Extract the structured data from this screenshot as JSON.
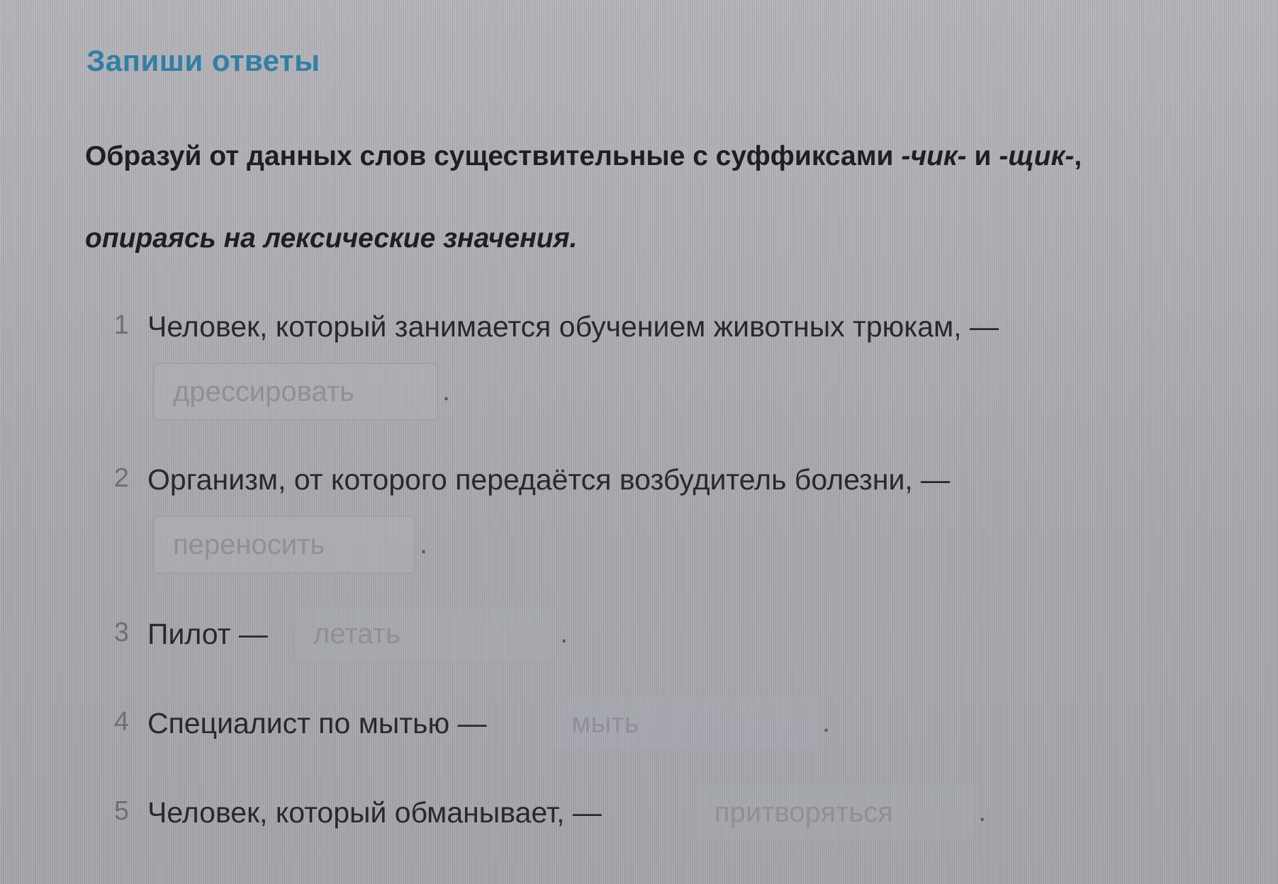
{
  "exercise": {
    "section_title": "Запиши ответы",
    "instruction_part1": "Образуй от данных слов существительные с суффиксами ",
    "suffix1": "-чик-",
    "instruction_and": " и ",
    "suffix2": "-щик-",
    "instruction_comma": ",",
    "instruction_line2": "опираясь на лексические значения.",
    "period": "."
  },
  "items": [
    {
      "number": "1",
      "text": "Человек, который занимается обучением животных трюкам, —",
      "placeholder": "дрессировать"
    },
    {
      "number": "2",
      "text": "Организм, от которого передаётся возбудитель болезни, —",
      "placeholder": "переносить"
    },
    {
      "number": "3",
      "text": "Пилот —",
      "placeholder": "летать"
    },
    {
      "number": "4",
      "text": "Специалист по мытью —",
      "placeholder": "мыть"
    },
    {
      "number": "5",
      "text": "Человек, который обманывает, —",
      "placeholder": "притворяться"
    }
  ]
}
